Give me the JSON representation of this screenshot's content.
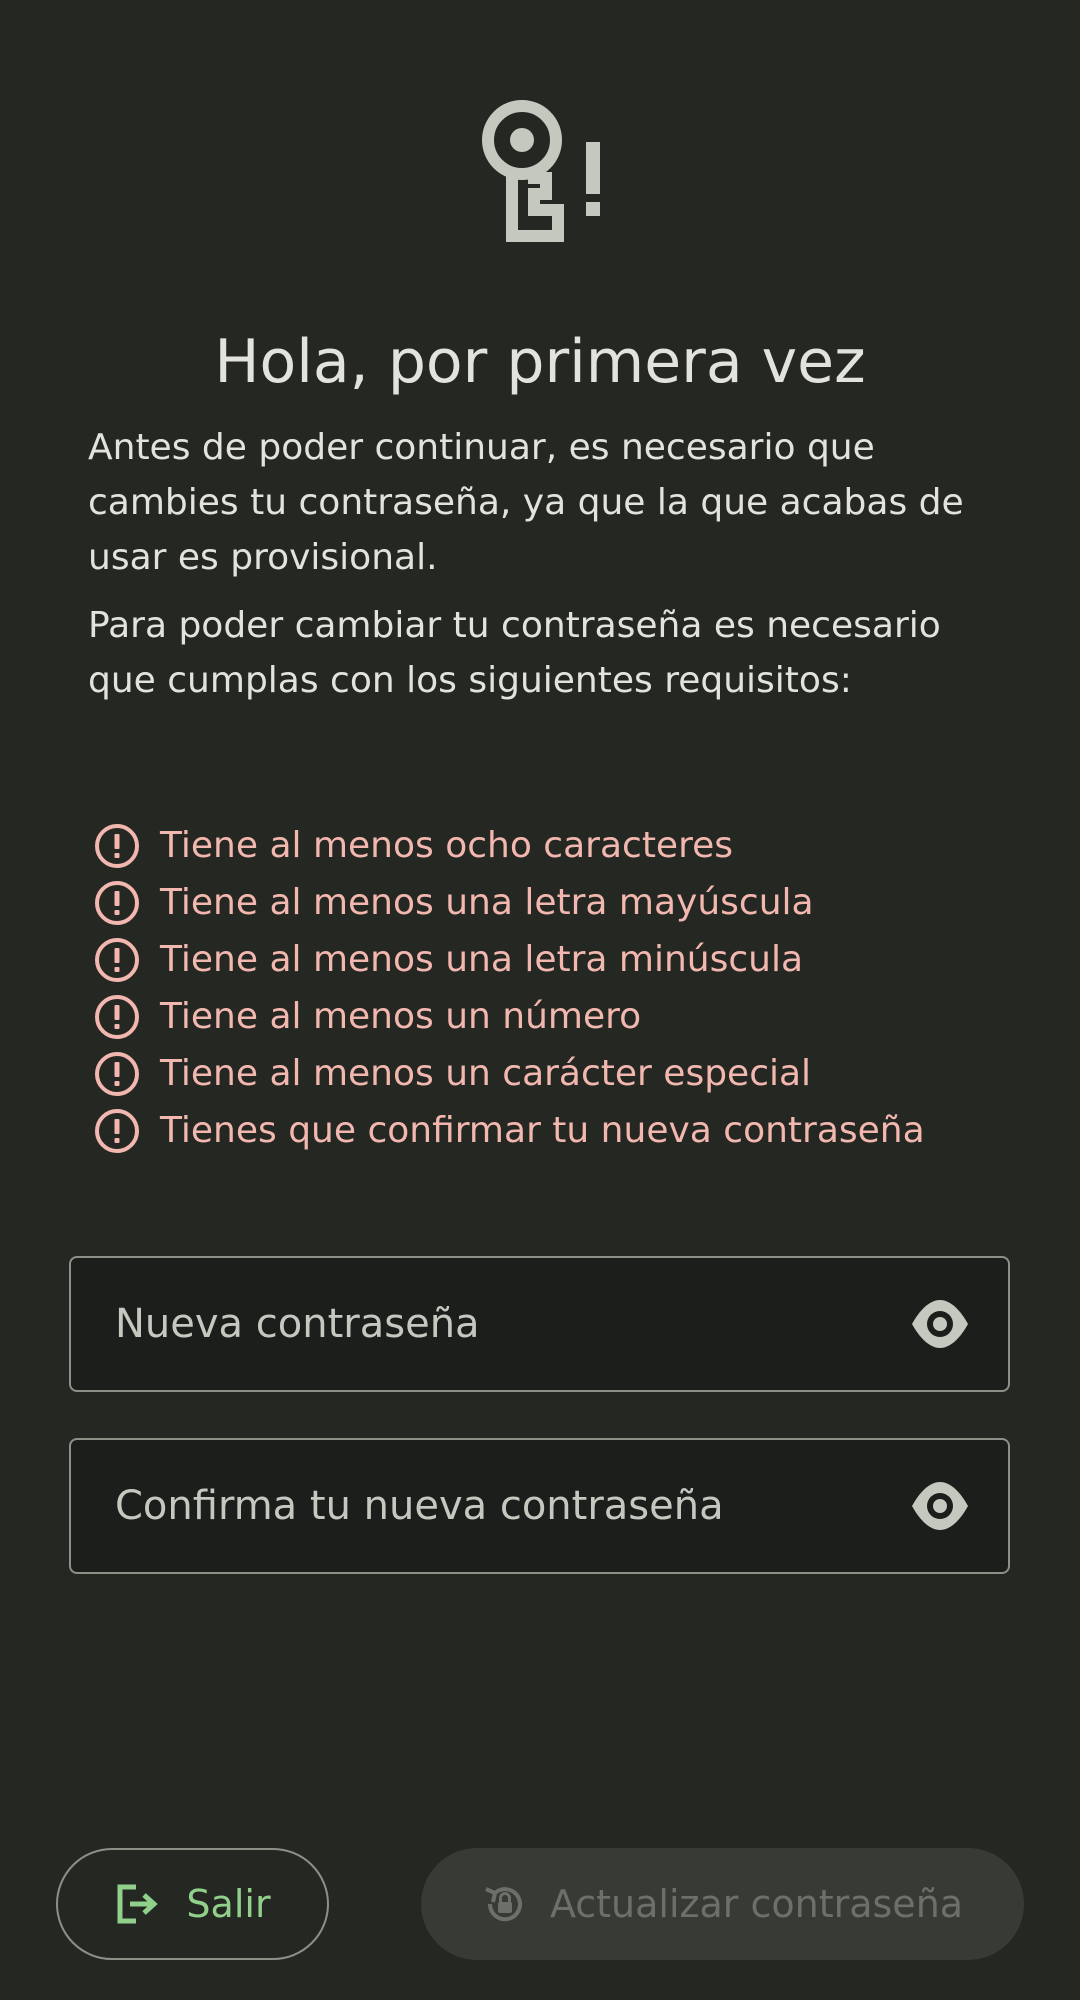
{
  "header": {
    "icon": "password-key-alert-icon",
    "title": "Hola, por primera vez"
  },
  "intro": {
    "paragraph1": "Antes de poder continuar, es necesario que cambies tu contraseña, ya que la que acabas de usar es provisional.",
    "paragraph2": "Para poder cambiar tu contraseña es necesario que cumplas con los siguientes requisitos:"
  },
  "requirements": {
    "icon": "error-circle-icon",
    "color": "#f2b7ae",
    "items": [
      "Tiene al menos ocho caracteres",
      "Tiene al menos una letra mayúscula",
      "Tiene al menos una letra minúscula",
      "Tiene al menos un número",
      "Tiene al menos un carácter especial",
      "Tienes que confirmar tu nueva contraseña"
    ]
  },
  "form": {
    "new_password": {
      "placeholder": "Nueva contraseña",
      "value": "",
      "toggle_icon": "eye-icon"
    },
    "confirm_password": {
      "placeholder": "Confirma tu nueva contraseña",
      "value": "",
      "toggle_icon": "eye-icon"
    }
  },
  "actions": {
    "exit": {
      "label": "Salir",
      "icon": "logout-icon",
      "color": "#90d08a"
    },
    "update": {
      "label": "Actualizar contraseña",
      "icon": "lock-reset-icon",
      "disabled": true
    }
  },
  "theme": {
    "background": "#252723",
    "text": "#e2e3dd",
    "outline": "#8c9188"
  }
}
